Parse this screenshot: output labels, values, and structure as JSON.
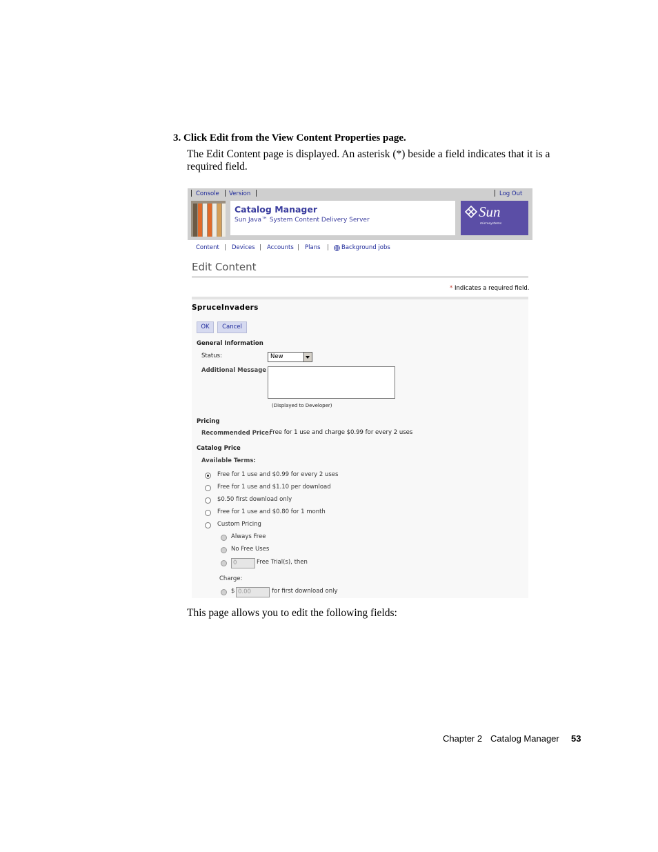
{
  "doc": {
    "step_number": "3.",
    "step_text": "Click Edit from the View Content Properties page.",
    "intro": "The Edit Content page is displayed. An asterisk (*) beside a field indicates that it is a required field.",
    "after_text": "This page allows you to edit the following fields:",
    "footer_chapter": "Chapter 2",
    "footer_title": "Catalog Manager",
    "page_number": "53"
  },
  "screenshot": {
    "util_nav": {
      "console": "Console",
      "version": "Version",
      "logout": "Log Out"
    },
    "app_title": "Catalog Manager",
    "app_subtitle": "Sun Java™ System Content Delivery Server",
    "brand": {
      "wordmark": "Sun",
      "tagline": "microsystems",
      "color": "#5b4ea6"
    },
    "tabs": [
      "Content",
      "Devices",
      "Accounts",
      "Plans",
      "Background jobs"
    ],
    "page_title": "Edit Content",
    "required_note": "Indicates a required field.",
    "required_marker": "*",
    "content_name": "SpruceInvaders",
    "buttons": {
      "ok": "OK",
      "cancel": "Cancel"
    },
    "general": {
      "heading": "General Information",
      "status_label": "Status:",
      "status_value": "New",
      "message_label": "Additional Message :",
      "message_note": "(Displayed to Developer)"
    },
    "pricing": {
      "heading": "Pricing",
      "recommended_label": "Recommended Price:",
      "recommended_value": "Free for 1 use and charge $0.99 for every 2 uses"
    },
    "catalog_price": {
      "heading": "Catalog Price",
      "terms_label": "Available Terms:",
      "options": [
        "Free for 1 use and $0.99 for every 2 uses",
        "Free for 1 use and $1.10 per download",
        "$0.50 first download only",
        "Free for 1 use and $0.80 for 1 month",
        "Custom Pricing"
      ],
      "selected_index": 0,
      "custom": {
        "always_free": "Always Free",
        "no_free": "No Free Uses",
        "trials_value": "0",
        "trials_suffix": "Free Trial(s), then",
        "charge_label": "Charge:",
        "currency": "$",
        "charge_value": "0.00",
        "charge_suffix": "for first download only"
      }
    }
  }
}
